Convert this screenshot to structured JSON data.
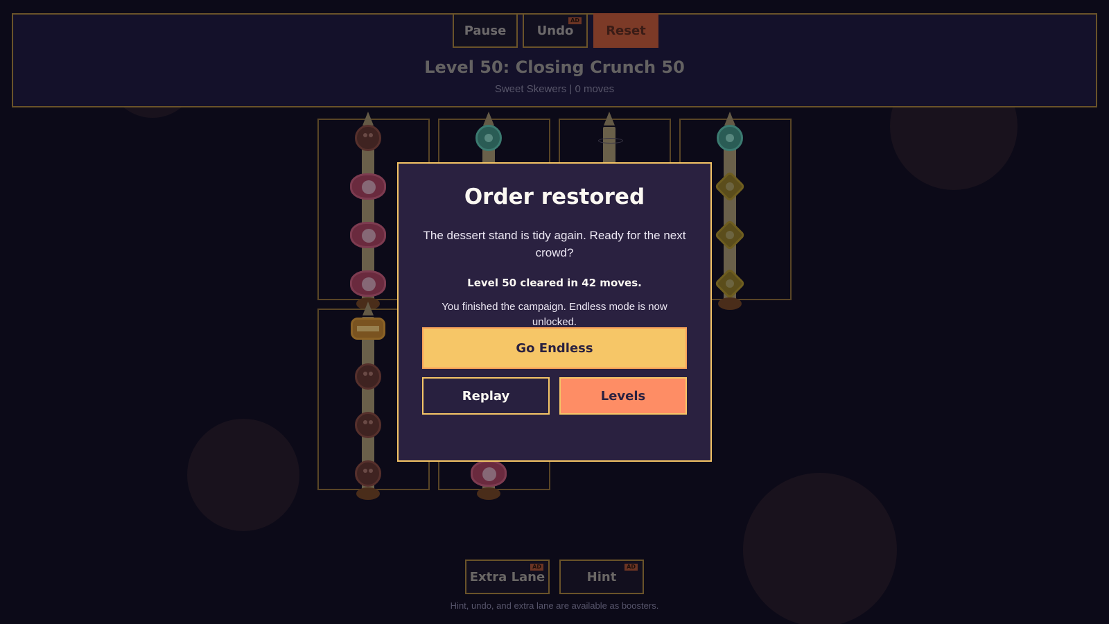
{
  "toolbar": {
    "pause_label": "Pause",
    "undo_label": "Undo",
    "undo_badge": "AD",
    "reset_label": "Reset"
  },
  "level": {
    "title": "Level 50: Closing Crunch 50",
    "subtitle": "Sweet Skewers | 0 moves"
  },
  "board": {
    "lanes": [
      {
        "pieces": [
          "chocolate",
          "pink",
          "pink",
          "pink"
        ]
      },
      {
        "pieces": [
          "teal"
        ]
      },
      {
        "pieces": []
      },
      {
        "pieces": [
          "teal",
          "yellow",
          "yellow",
          "yellow"
        ]
      },
      {
        "pieces": [
          "caramel",
          "chocolate",
          "chocolate",
          "chocolate"
        ]
      },
      {
        "pieces": [
          "pink"
        ]
      }
    ]
  },
  "boosters": {
    "extra_lane_label": "Extra Lane",
    "extra_lane_badge": "AD",
    "hint_label": "Hint",
    "hint_badge": "AD",
    "footer": "Hint, undo, and extra lane are available as boosters."
  },
  "modal": {
    "title": "Order restored",
    "message": "The dessert stand is tidy again. Ready for the next crowd?",
    "result": "Level 50 cleared in 42 moves.",
    "note": "You finished the campaign. Endless mode is now unlocked.",
    "go_endless_label": "Go Endless",
    "replay_label": "Replay",
    "levels_label": "Levels"
  },
  "colors": {
    "accent": "#f6c667",
    "secondary": "#fe8d65",
    "modal_bg": "#2a2140",
    "page_bg": "#0c0a18"
  }
}
